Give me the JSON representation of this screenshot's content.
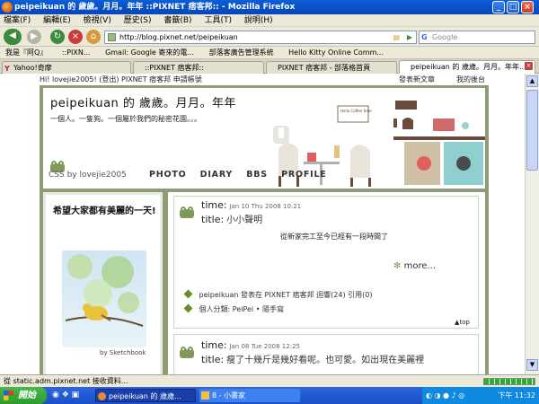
{
  "window": {
    "title": "peipeikuan 的 歲歲。月月。年年 ::PIXNET 痞客邦:: - Mozilla Firefox"
  },
  "menu": [
    "檔案(F)",
    "編輯(E)",
    "檢視(V)",
    "歷史(S)",
    "書籤(B)",
    "工具(T)",
    "說明(H)"
  ],
  "nav": {
    "url": "http://blog.pixnet.net/peipeikuan",
    "search_placeholder": "Google"
  },
  "bookmarks": [
    "我是『阿Q』",
    "::PIXN...",
    "Gmail: Google 寄來的電...",
    "部落客廣告管理系統",
    "Hello Kitty Online Comm..."
  ],
  "tabs": [
    {
      "label": "Yahoo!奇摩"
    },
    {
      "label": "::PIXNET 痞客邦::"
    },
    {
      "label": "PIXNET 痞客邦 - 部落格首頁"
    },
    {
      "label": "peipeikuan 的 歲歲。月月。年年..."
    }
  ],
  "blog": {
    "top_left": "Hi! lovejie2005! (登出) PIXNET 痞客邦 申請帳號",
    "top_right_post": "發表新文章",
    "top_right_admin": "我的後台",
    "title": "peipeikuan 的 歲歲。月月。年年",
    "subtitle": "一個人。一隻狗。一個屬於我們的秘密花園。。。",
    "css_by": "CSS by lovejie2005",
    "nav": [
      "PHOTO",
      "DIARY",
      "BBS",
      "PROFILE"
    ],
    "sign_text": "Hello Coffee time",
    "sidebar_title": "希望大家都有美麗的一天!",
    "sidebar_credit": "by Sketchbook",
    "posts": [
      {
        "time_label": "time:",
        "date": "Jan 10 Thu 2008 10:21",
        "title_label": "title:",
        "title": "小小聲明",
        "body": "從新家完工至今已經有一段時間了",
        "more": "more...",
        "info": "peipeikuan 發表在 PIXNET 痞客邦 迴響(24) 引用(0)",
        "category": "個人分類: PeiPei • 隨手寫",
        "top": "▲top"
      },
      {
        "time_label": "time:",
        "date": "Jan 08 Tue 2008 12:25",
        "title_label": "title:",
        "title": "瘦了十幾斤是幾好看呢。也可愛。如出現在美麗裡"
      }
    ]
  },
  "status": "從 static.adm.pixnet.net 接收資料...",
  "taskbar": {
    "start": "開始",
    "tasks": [
      "peipeikuan 的 歲歲...",
      "8 - 小書家"
    ],
    "time": "下午 11:32"
  },
  "colors": {
    "frame": "#8d9c74",
    "title_bar": "#0a5fd8",
    "accent": "#6a8a2a"
  }
}
